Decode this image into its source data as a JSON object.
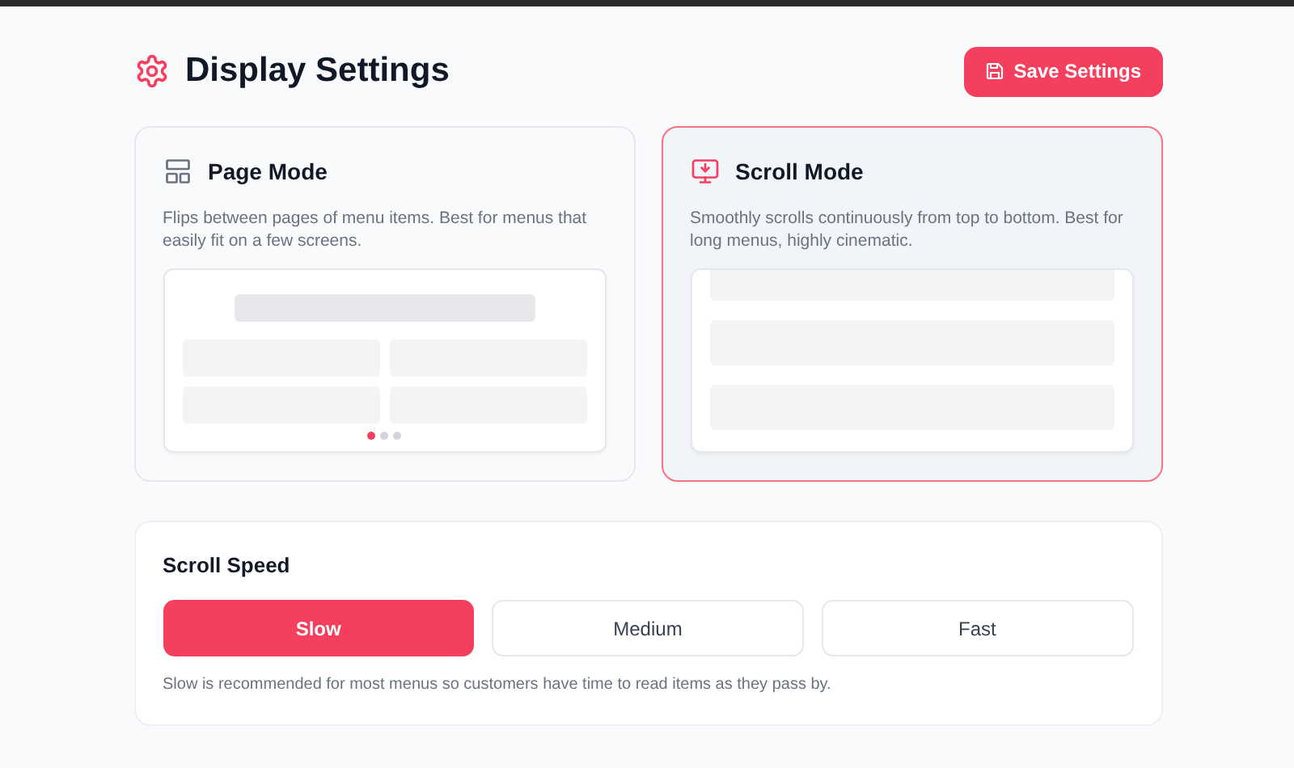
{
  "header": {
    "title": "Display Settings",
    "save_button": "Save Settings"
  },
  "modes": [
    {
      "kind": "page",
      "title": "Page Mode",
      "description": "Flips between pages of menu items. Best for menus that easily fit on a few screens.",
      "selected": false,
      "page_dots": [
        {
          "selected": true
        },
        {
          "selected": false
        },
        {
          "selected": false
        }
      ]
    },
    {
      "kind": "scroll",
      "title": "Scroll Mode",
      "description": "Smoothly scrolls continuously from top to bottom. Best for long menus, highly cinematic.",
      "selected": true
    }
  ],
  "scroll_speed": {
    "title": "Scroll Speed",
    "options": [
      {
        "label": "Slow",
        "selected": true
      },
      {
        "label": "Medium",
        "selected": false
      },
      {
        "label": "Fast",
        "selected": false
      }
    ],
    "hint": "Slow is recommended for most menus so customers have time to read items as they pass by."
  }
}
